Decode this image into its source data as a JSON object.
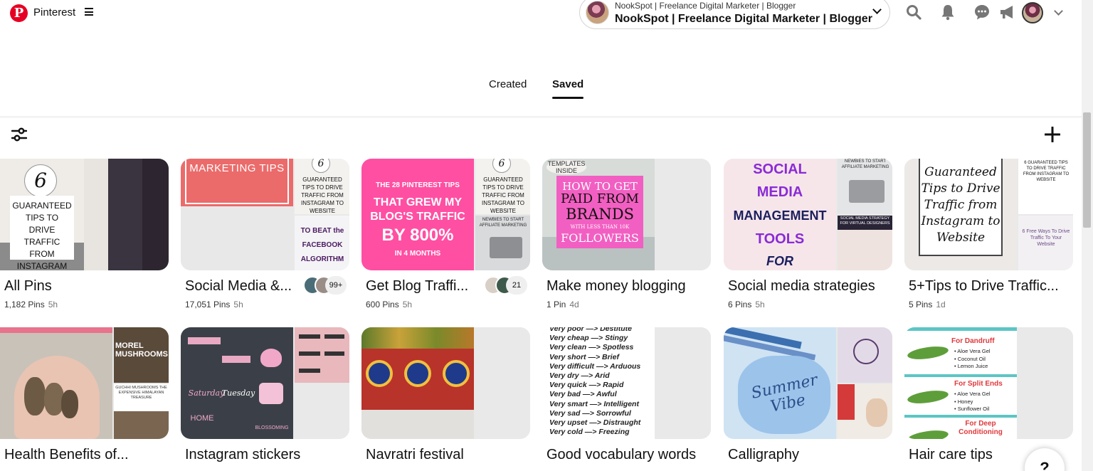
{
  "header": {
    "brand": "Pinterest",
    "account_small": "NookSpot | Freelance Digital Marketer | Blogger",
    "account_big": "NookSpot | Freelance Digital Marketer | Blogger",
    "icons": [
      "search-icon",
      "notifications-icon",
      "messages-icon",
      "updates-icon",
      "avatar",
      "chevron-down-icon"
    ]
  },
  "tabs": [
    {
      "label": "Created",
      "active": false
    },
    {
      "label": "Saved",
      "active": true
    }
  ],
  "toolbar": {
    "filter_icon": "filter-sliders-icon",
    "add_icon": "plus-icon"
  },
  "boards": [
    {
      "title": "All Pins",
      "pins": "1,182 Pins",
      "time": "5h",
      "cover_text": [
        "6",
        "GUARANTEED TIPS TO DRIVE TRAFFIC FROM INSTAGRAM TO WEBSITE"
      ]
    },
    {
      "title": "Social Media &...",
      "pins": "17,051 Pins",
      "time": "5h",
      "collaborators": "99+",
      "cover_text": [
        "MARKETING TIPS",
        "6",
        "GUARANTEED TIPS TO DRIVE TRAFFIC FROM INSTAGRAM TO WEBSITE",
        "TO BEAT the FACEBOOK ALGORITHM"
      ]
    },
    {
      "title": "Get Blog Traffi...",
      "pins": "600 Pins",
      "time": "5h",
      "collaborators": "21",
      "cover_text": [
        "THE 28 PINTEREST TIPS",
        "THAT GREW MY BLOG'S TRAFFIC",
        "BY 800%",
        "IN 4 MONTHS",
        "6",
        "GUARANTEED TIPS TO DRIVE TRAFFIC FROM INSTAGRAM TO WEBSITE",
        "NEWBIES TO START AFFILIATE MARKETING"
      ]
    },
    {
      "title": "Make money blogging",
      "pins": "1 Pin",
      "time": "4d",
      "cover_text": [
        "TEMPLATES INSIDE",
        "HOW TO GET",
        "PAID FROM",
        "BRANDS",
        "WITH LESS THAN 10K",
        "FOLLOWERS"
      ]
    },
    {
      "title": "Social media strategies",
      "pins": "6 Pins",
      "time": "5h",
      "cover_text": [
        "SOCIAL",
        "MEDIA",
        "MANAGEMENT",
        "TOOLS",
        "FOR",
        "NEWBIES TO START AFFILIATE MARKETING",
        "SOCIAL MEDIA STRATEGY FOR VIRTUAL DESIGNERS"
      ]
    },
    {
      "title": "5+Tips to Drive Traffic...",
      "pins": "5 Pins",
      "time": "1d",
      "cover_text": [
        "Guaranteed Tips to Drive Traffic from Instagram to Website",
        "6 GUARANTEED TIPS TO DRIVE TRAFFIC FROM INSTAGRAM TO WEBSITE",
        "6 Free Ways To Drive Traffic To Your Website"
      ]
    },
    {
      "title": "Health Benefits of...",
      "pins": "",
      "time": "",
      "cover_text": [
        "MOREL MUSHROOMS",
        "GUCHHI MUSHROOMS THE EXPENSIVE HIMALAYAN TREASURE"
      ]
    },
    {
      "title": "Instagram stickers",
      "pins": "",
      "time": "",
      "cover_text": [
        "Saturday",
        "Tuesday",
        "HOME",
        "BLOSSOMING"
      ]
    },
    {
      "title": "Navratri festival",
      "pins": "",
      "time": "",
      "cover_text": []
    },
    {
      "title": "Good vocabulary words",
      "pins": "",
      "time": "",
      "cover_text": [
        "Very poor —> Destitute",
        "Very cheap —> Stingy",
        "Very clean —> Spotless",
        "Very short —> Brief",
        "Very difficult —> Arduous",
        "Very dry —> Arid",
        "Very quick —> Rapid",
        "Very bad —> Awful",
        "Very smart —> Intelligent",
        "Very sad —> Sorrowful",
        "Very upset —> Distraught",
        "Very cold —> Freezing"
      ]
    },
    {
      "title": "Calligraphy",
      "pins": "",
      "time": "",
      "cover_text": [
        "Summer Vibe"
      ]
    },
    {
      "title": "Hair care tips",
      "pins": "",
      "time": "",
      "cover_text": [
        "For Dandruff",
        "Aloe Vera Gel",
        "Coconut Oil",
        "Lemon Juice",
        "For Split Ends",
        "Aloe Vera Gel",
        "Honey",
        "Sunflower Oil",
        "For Deep Conditioning"
      ]
    }
  ],
  "help_button": "?"
}
